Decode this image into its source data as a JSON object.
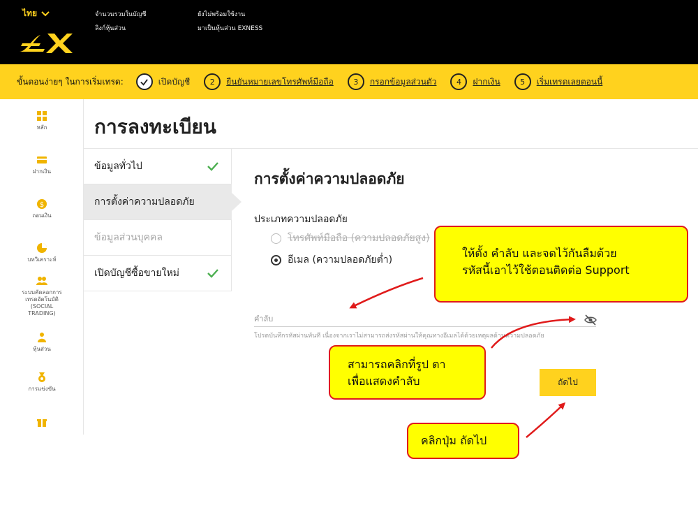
{
  "header": {
    "language": "ไทย",
    "links_col1": [
      "จำนวนรวมในบัญชี",
      "ลิงก์หุ้นส่วน"
    ],
    "links_col2": [
      "ยังไม่พร้อมใช้งาน",
      "มาเป็นหุ้นส่วน EXNESS"
    ],
    "brand_color": "#ffd21e"
  },
  "steps": {
    "intro": "ขั้นตอนง่ายๆ ในการเริ่มเทรด:",
    "items": [
      {
        "num": "",
        "label": "เปิดบัญชี",
        "done": true
      },
      {
        "num": "2",
        "label": "ยืนยันหมายเลขโทรศัพท์มือถือ"
      },
      {
        "num": "3",
        "label": "กรอกข้อมูลส่วนตัว"
      },
      {
        "num": "4",
        "label": "ฝากเงิน"
      },
      {
        "num": "5",
        "label": "เริ่มเทรดเลยตอนนี้"
      }
    ]
  },
  "sidenav": {
    "items": [
      {
        "label": "หลัก",
        "icon": "dashboard-icon"
      },
      {
        "label": "ฝากเงิน",
        "icon": "card-icon"
      },
      {
        "label": "ถอนเงิน",
        "icon": "dollar-icon"
      },
      {
        "label": "บทวิเคราะห์",
        "icon": "pie-chart-icon"
      },
      {
        "label": "ระบบคัดลอกการเทรดอัตโนมัติ (SOCIAL TRADING)",
        "icon": "people-icon"
      },
      {
        "label": "หุ้นส่วน",
        "icon": "partner-icon"
      },
      {
        "label": "การแข่งขัน",
        "icon": "medal-icon"
      },
      {
        "label": "",
        "icon": "gift-icon"
      }
    ]
  },
  "page": {
    "title": "การลงทะเบียน"
  },
  "submenu": {
    "items": [
      {
        "label": "ข้อมูลทั่วไป",
        "state": "done"
      },
      {
        "label": "การตั้งค่าความปลอดภัย",
        "state": "active"
      },
      {
        "label": "ข้อมูลส่วนบุคคล",
        "state": "disabled"
      },
      {
        "label": "เปิดบัญชีซื้อขายใหม่",
        "state": "done"
      }
    ]
  },
  "form": {
    "title": "การตั้งค่าความปลอดภัย",
    "security_type_label": "ประเภทความปลอดภัย",
    "option_phone": "โทรศัพท์มือถือ (ความปลอดภัยสูง)",
    "option_email": "อีเมล (ความปลอดภัยต่ำ)",
    "selected": "email",
    "password_label": "คำลับ",
    "password_hint": "โปรดบันทึกรหัสผ่านทันที เนื่องจากเราไม่สามารถส่งรหัสผ่านให้คุณทางอีเมลได้ด้วยเหตุผลด้านความปลอดภัย",
    "next_button": "ถัดไป"
  },
  "annotations": {
    "password_note_line1": "ให้ตั้ง คำลับ และจดไว้กันลืมด้วย",
    "password_note_line2": "รหัสนี้เอาไว้ใช้ตอนติดต่อ Support",
    "eye_note_line1": "สามารถคลิกที่รูป ตา",
    "eye_note_line2": "เพื่อแสดงคำลับ",
    "next_note": "คลิกปุ่ม ถัดไป",
    "callout_color": "#ffff00",
    "arrow_color": "#e01b1b"
  }
}
